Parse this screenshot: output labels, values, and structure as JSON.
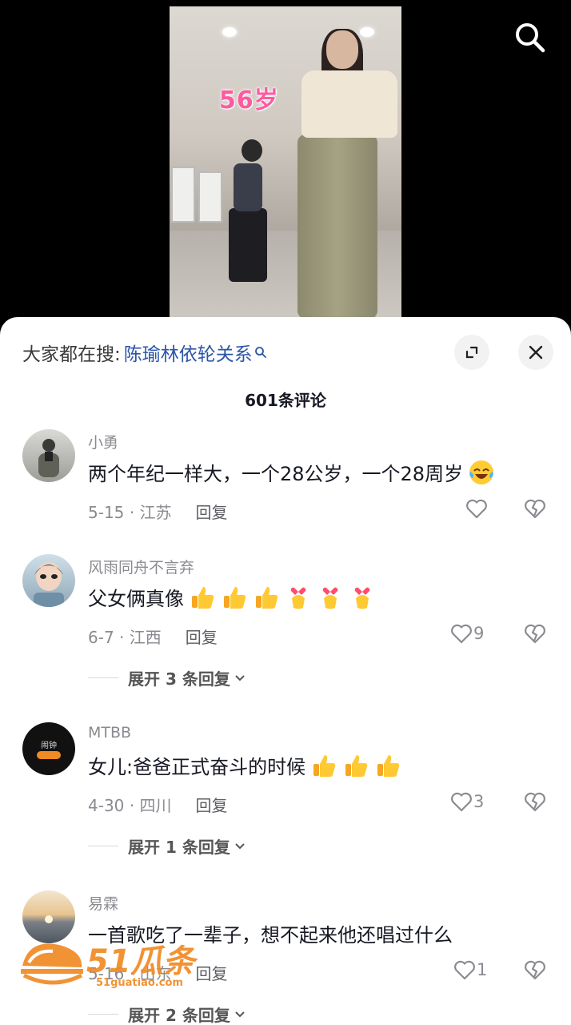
{
  "video": {
    "age_caption": "56岁"
  },
  "panel": {
    "search_prefix": "大家都在搜:",
    "search_query": "陈瑜林依轮关系",
    "comment_count": "601条评论"
  },
  "comments": [
    {
      "username": "小勇",
      "text": "两个年纪一样大，一个28公岁，一个28周岁",
      "emoji": [
        "laugh-cry-emoji"
      ],
      "date_location": "5-15 · 江苏",
      "reply_label": "回复",
      "likes": ""
    },
    {
      "username": "风雨同舟不言弃",
      "text": "父女俩真像",
      "emoji": [
        "thumbs-up-emoji",
        "thumbs-up-emoji",
        "thumbs-up-emoji",
        "finger-heart-emoji",
        "finger-heart-emoji",
        "finger-heart-emoji"
      ],
      "date_location": "6-7 · 江西",
      "reply_label": "回复",
      "likes": "9",
      "expand_label": "展开 3 条回复"
    },
    {
      "username": "MTBB",
      "text": "女儿:爸爸正式奋斗的时候",
      "emoji": [
        "thumbs-up-emoji",
        "thumbs-up-emoji",
        "thumbs-up-emoji"
      ],
      "date_location": "4-30 · 四川",
      "reply_label": "回复",
      "likes": "3",
      "expand_label": "展开 1 条回复",
      "avatar_text": "闹钟"
    },
    {
      "username": "易霖",
      "text": "一首歌吃了一辈子，想不起来他还唱过什么",
      "emoji": [],
      "date_location": "5-16 · 山东",
      "reply_label": "回复",
      "likes": "1",
      "expand_label": "展开 2 条回复"
    }
  ],
  "watermark": {
    "brand": "51瓜条",
    "url": "51guatiao.com"
  },
  "colors": {
    "search_query": "#2c55a8",
    "age_caption": "#ff5aa0",
    "watermark": "#f08a24"
  }
}
